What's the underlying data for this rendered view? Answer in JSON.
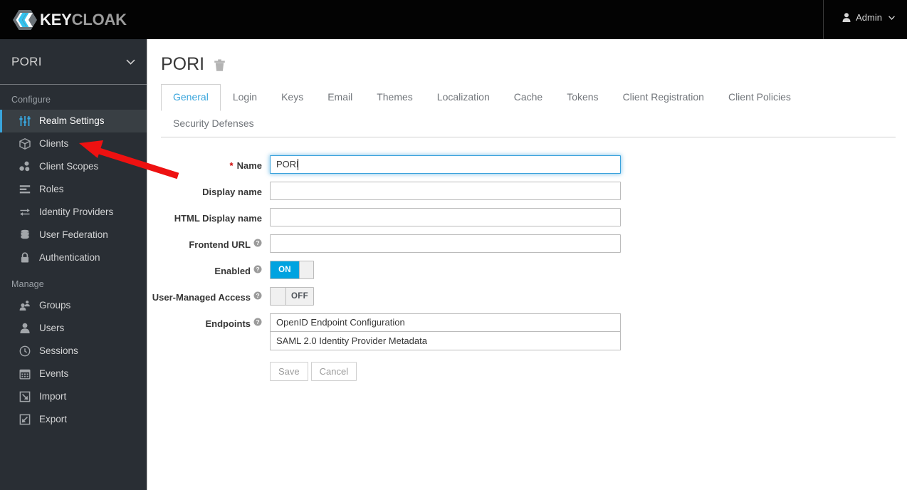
{
  "masthead": {
    "brand_key": "KEY",
    "brand_cloak": "CLOAK",
    "logo_icon": "keycloak-hexagon-logo",
    "user_icon": "user-icon",
    "user_label": "Admin",
    "caret_icon": "chevron-down-icon"
  },
  "sidebar": {
    "realm": {
      "name": "PORI",
      "caret_icon": "chevron-down-icon"
    },
    "groups": [
      {
        "label": "Configure",
        "items": [
          {
            "label": "Realm Settings",
            "icon": "sliders-icon",
            "active": true
          },
          {
            "label": "Clients",
            "icon": "cube-icon",
            "active": false
          },
          {
            "label": "Client Scopes",
            "icon": "molecule-icon",
            "active": false
          },
          {
            "label": "Roles",
            "icon": "list-icon",
            "active": false
          },
          {
            "label": "Identity Providers",
            "icon": "exchange-arrows-icon",
            "active": false
          },
          {
            "label": "User Federation",
            "icon": "database-icon",
            "active": false
          },
          {
            "label": "Authentication",
            "icon": "lock-icon",
            "active": false
          }
        ]
      },
      {
        "label": "Manage",
        "items": [
          {
            "label": "Groups",
            "icon": "users-group-icon",
            "active": false
          },
          {
            "label": "Users",
            "icon": "user-icon",
            "active": false
          },
          {
            "label": "Sessions",
            "icon": "clock-icon",
            "active": false
          },
          {
            "label": "Events",
            "icon": "calendar-icon",
            "active": false
          },
          {
            "label": "Import",
            "icon": "import-arrow-icon",
            "active": false
          },
          {
            "label": "Export",
            "icon": "export-arrow-icon",
            "active": false
          }
        ]
      }
    ]
  },
  "page": {
    "title": "PORI",
    "delete_icon": "trash-icon",
    "tabs": [
      {
        "label": "General",
        "active": true
      },
      {
        "label": "Login",
        "active": false
      },
      {
        "label": "Keys",
        "active": false
      },
      {
        "label": "Email",
        "active": false
      },
      {
        "label": "Themes",
        "active": false
      },
      {
        "label": "Localization",
        "active": false
      },
      {
        "label": "Cache",
        "active": false
      },
      {
        "label": "Tokens",
        "active": false
      },
      {
        "label": "Client Registration",
        "active": false
      },
      {
        "label": "Client Policies",
        "active": false
      },
      {
        "label": "Security Defenses",
        "active": false
      }
    ]
  },
  "form": {
    "name": {
      "label": "Name",
      "required_marker": "*",
      "value": "PORI",
      "placeholder": ""
    },
    "display_name": {
      "label": "Display name",
      "value": "",
      "placeholder": ""
    },
    "html_display_name": {
      "label": "HTML Display name",
      "value": "",
      "placeholder": ""
    },
    "frontend_url": {
      "label": "Frontend URL",
      "value": "",
      "placeholder": "",
      "help_icon": "help-circle-icon"
    },
    "enabled": {
      "label": "Enabled",
      "state": "ON",
      "help_icon": "help-circle-icon"
    },
    "user_managed_access": {
      "label": "User-Managed Access",
      "state": "OFF",
      "help_icon": "help-circle-icon"
    },
    "endpoints": {
      "label": "Endpoints",
      "help_icon": "help-circle-icon",
      "items": [
        "OpenID Endpoint Configuration",
        "SAML 2.0 Identity Provider Metadata"
      ]
    },
    "save_label": "Save",
    "cancel_label": "Cancel"
  },
  "annotation": {
    "arrow_color": "#ee1111",
    "arrow_target": "Clients"
  },
  "colors": {
    "accent_blue": "#39a5dc",
    "toggle_on": "#00a3e0",
    "sidebar_bg": "#292e34",
    "masthead_bg": "#030303",
    "required_red": "#cc0000"
  }
}
